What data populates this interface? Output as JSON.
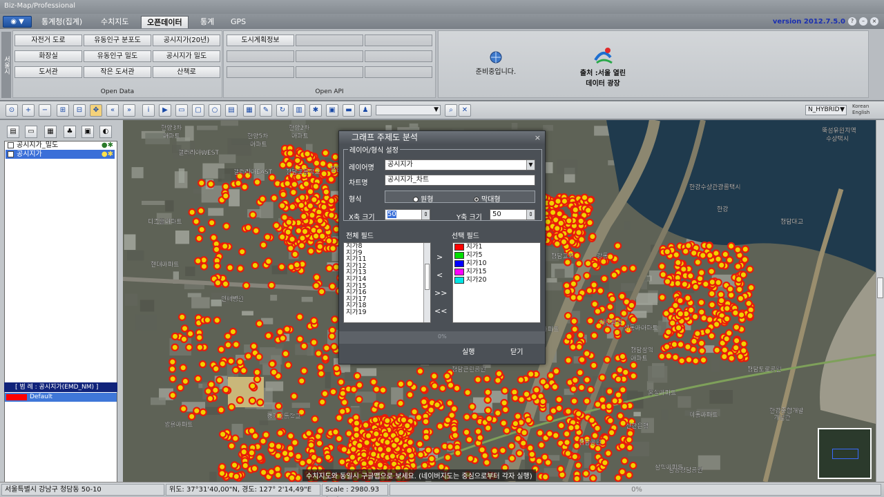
{
  "app": {
    "title": "Biz-Map/Professional"
  },
  "menu": {
    "app_button": "▼",
    "tabs": [
      "통계청(집계)",
      "수치지도",
      "오픈데이터",
      "통계",
      "GPS"
    ],
    "active_tab": "오픈데이터",
    "version": "version 2012.7.5.0"
  },
  "ribbon": {
    "side_label": "서울시",
    "open_data": {
      "label": "Open Data",
      "buttons": [
        [
          "자전거 도로",
          "유동인구 분포도",
          "공시지가(20년)"
        ],
        [
          "화장실",
          "유동인구 밀도",
          "공시지가 밀도"
        ],
        [
          "도서관",
          "작은 도서관",
          "산책로"
        ]
      ]
    },
    "open_api": {
      "label": "Open API",
      "buttons": [
        "도시계획정보"
      ]
    },
    "preparing": "준비중입니다.",
    "source_line1": "출처 :서울 열린",
    "source_line2": "데이터 광장"
  },
  "toolbar": {
    "map_type": "N_HYBRID",
    "lang": [
      "Korean",
      "English"
    ]
  },
  "layers": {
    "items": [
      {
        "name": "공시지가_밀도",
        "selected": false
      },
      {
        "name": "공시지가",
        "selected": true
      }
    ],
    "legend_title": "[ 범 례 : 공시지가(EMD_NM) ]",
    "legend_items": [
      {
        "label": "Default",
        "color": "#ff0000"
      }
    ]
  },
  "dialog": {
    "title": "그래프 주제도 분석",
    "group_label": "레이어/형식 설정",
    "layer_label": "레이어명",
    "layer_value": "공시지가",
    "chart_label": "차트명",
    "chart_value": "공시지가_차트",
    "type_label": "형식",
    "type_options": [
      "원형",
      "막대형"
    ],
    "type_selected": "막대형",
    "x_label": "X축 크기",
    "x_value": "50",
    "y_label": "Y축 크기",
    "y_value": "50",
    "all_fields_label": "전체 필드",
    "all_fields": [
      "지가8",
      "지가9",
      "지가11",
      "지가12",
      "지가13",
      "지가14",
      "지가15",
      "지가16",
      "지가17",
      "지가18",
      "지가19"
    ],
    "selected_fields_label": "선택 필드",
    "selected_fields": [
      {
        "name": "지가1",
        "color": "#ff0000"
      },
      {
        "name": "지가5",
        "color": "#00dd00"
      },
      {
        "name": "지가10",
        "color": "#0000ff"
      },
      {
        "name": "지가15",
        "color": "#ff00ff"
      },
      {
        "name": "지가20",
        "color": "#00e5e5"
      }
    ],
    "move_buttons": [
      ">",
      "<",
      ">>",
      "<<"
    ],
    "progress": "0%",
    "run_label": "실행",
    "close_label": "닫기"
  },
  "map": {
    "subtitle": "수치지도와 동일시 구글맵으로 보세요. (네이버지도는 중심으로부터 각자 실행)",
    "labels": [
      "한양3차",
      "아파트",
      "한양2차",
      "아파트",
      "한양5차",
      "아파트",
      "갤러리아WEST",
      "갤러리아EAST",
      "청담고등학교",
      "청담동성당",
      "한강",
      "한강수상관광콜택시",
      "뚝섬유원지역",
      "수상택시",
      "청담대교",
      "청담근린공원",
      "청담도로공원",
      "한강중합개발",
      "기념관",
      "신동아아파트",
      "청담삼익",
      "아파트",
      "청담교회",
      "아이파크",
      "진흥아파트",
      "홍실아파트",
      "삼익아파트",
      "이동아파트",
      "쌍용아파트",
      "인애병원",
      "디즈홀아파트",
      "현대아파트",
      "경기고등학교",
      "삼성청담공원",
      "청담공원",
      "신한은행",
      "강동",
      "GS칼텍스"
    ]
  },
  "status": {
    "address": "서울특별시 강남구 청담동 50-10",
    "coords": "위도: 37°31'40,00\"N, 경도: 127° 2'14,49\"E",
    "scale": "Scale : 2980.93 (16)",
    "progress": "0%"
  }
}
